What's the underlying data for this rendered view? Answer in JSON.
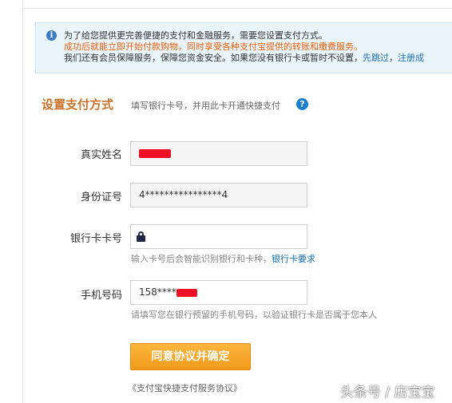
{
  "notice": {
    "line1": "为了给您提供更完善便捷的支付和金融服务，需要您设置支付方式。",
    "line2": "成功后就能立即开始付款购物，同时享受各种支付宝提供的转账和缴费服务。",
    "line3_text": "我们还有会员保障服务，保障您资金安全。如果您没有银行卡或暂时不设置，",
    "skip_link": "先跳过",
    "separator": "，",
    "register_link": "注册成"
  },
  "section": {
    "title": "设置支付方式",
    "subtitle": "填写银行卡号，并用此卡开通快捷支付",
    "help_symbol": "?"
  },
  "form": {
    "name": {
      "label": "真实姓名",
      "value": ""
    },
    "id": {
      "label": "身份证号",
      "value": "4****************4"
    },
    "card": {
      "label": "银行卡卡号",
      "value": "",
      "hint": "输入卡号后会智能识别银行和卡种，",
      "hint_link": "银行卡要求"
    },
    "phone": {
      "label": "手机号码",
      "value_prefix": "158****",
      "hint": "请填写您在银行预留的手机号码，以验证银行卡是否属于您本人"
    }
  },
  "submit_label": "同意协议并确定",
  "agreement_link": "《支付宝快捷支付服务协议》",
  "watermark": "头条号 / 店宝宝",
  "colors": {
    "section_title": "#c9722a",
    "notice_orange": "#e8610f",
    "link_blue": "#1a6fb8",
    "button_orange": "#f4a528",
    "redaction_red": "#ee1125"
  },
  "icons": {
    "info": "info-circle-icon",
    "help": "question-circle-icon",
    "card_lock": "lock-icon"
  }
}
